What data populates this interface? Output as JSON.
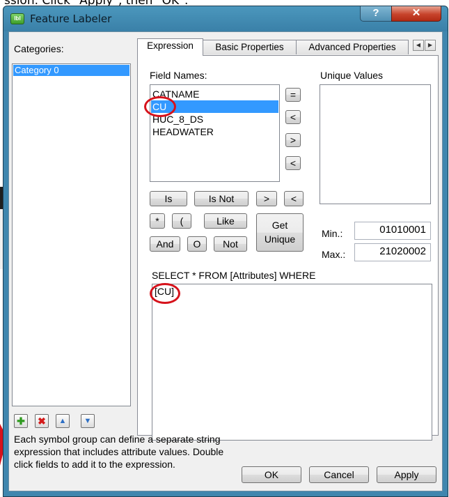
{
  "caption": "ssion. Click \"Apply\", then \"OK\".",
  "window": {
    "title": "Feature Labeler",
    "icon": "feature-labeler-app-icon",
    "help_glyph": "?",
    "close_glyph": "✕"
  },
  "categories": {
    "label": "Categories:",
    "items": [
      "Category 0"
    ]
  },
  "tabs": [
    {
      "label": "Expression",
      "active": true
    },
    {
      "label": "Basic Properties",
      "active": false
    },
    {
      "label": "Advanced Properties",
      "active": false
    }
  ],
  "tab_scroll": {
    "left": "◀",
    "right": "▶"
  },
  "expression": {
    "field_names_label": "Field Names:",
    "fields": [
      "CATNAME",
      "CU",
      "HUC_8_DS",
      "HEADWATER"
    ],
    "selected_field": "CU",
    "unique_values_label": "Unique Values",
    "unique_values": [],
    "side_ops": [
      "=",
      "<",
      ">",
      "<"
    ],
    "op_row1": [
      "Is",
      "Is Not",
      ">",
      "<"
    ],
    "op_row2": [
      "*",
      "(",
      "Like"
    ],
    "op_row3": [
      "And",
      "O",
      "Not"
    ],
    "get_unique_label": "Get Unique",
    "min_label": "Min.:",
    "min_value": "01010001",
    "max_label": "Max.:",
    "max_value": "21020002",
    "select_label": "SELECT * FROM [Attributes] WHERE",
    "expression_text": "[CU]"
  },
  "toolbar_icons": [
    "add-icon",
    "remove-icon",
    "move-up-icon",
    "move-down-icon"
  ],
  "toolbar_glyphs": {
    "add": "✚",
    "remove": "✖",
    "up": "▲",
    "down": "▼"
  },
  "help_text": "Each symbol group can define a separate string expression that includes attribute values.  Double click fields to add it to the expression.",
  "buttons": {
    "ok": "OK",
    "cancel": "Cancel",
    "apply": "Apply"
  },
  "colors": {
    "selection": "#3399ff",
    "annotation_ring": "#d6121b",
    "title_bar": "#4b97bd"
  }
}
